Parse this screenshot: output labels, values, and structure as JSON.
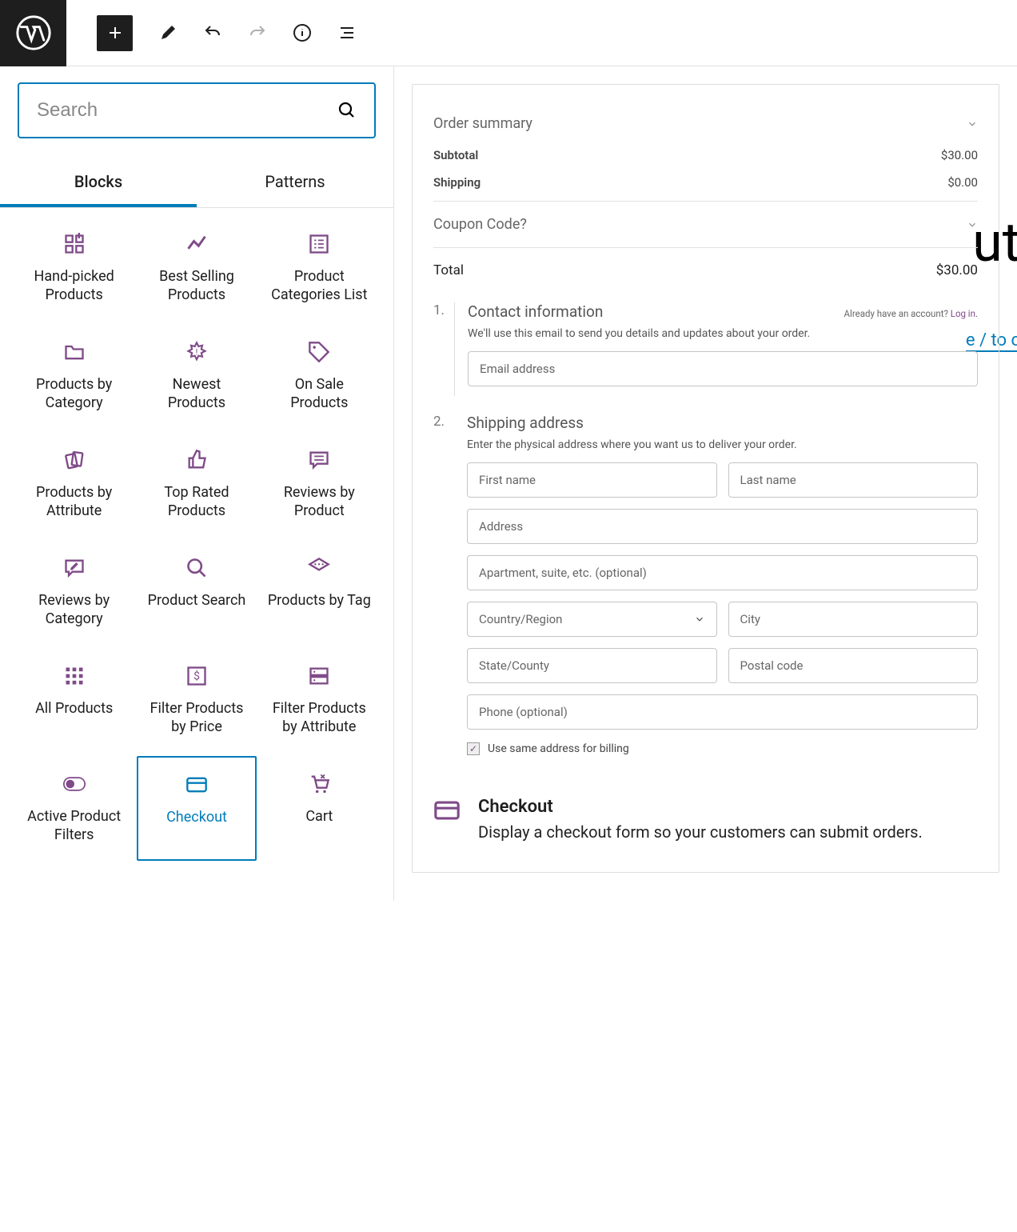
{
  "search": {
    "placeholder": "Search"
  },
  "tabs": {
    "blocks": "Blocks",
    "patterns": "Patterns"
  },
  "blocks": [
    {
      "label": "Hand-picked Products"
    },
    {
      "label": "Best Selling Products"
    },
    {
      "label": "Product Categories List"
    },
    {
      "label": "Products by Category"
    },
    {
      "label": "Newest Products"
    },
    {
      "label": "On Sale Products"
    },
    {
      "label": "Products by Attribute"
    },
    {
      "label": "Top Rated Products"
    },
    {
      "label": "Reviews by Product"
    },
    {
      "label": "Reviews by Category"
    },
    {
      "label": "Product Search"
    },
    {
      "label": "Products by Tag"
    },
    {
      "label": "All Products"
    },
    {
      "label": "Filter Products by Price"
    },
    {
      "label": "Filter Products by Attribute"
    },
    {
      "label": "Active Product Filters"
    },
    {
      "label": "Checkout"
    },
    {
      "label": "Cart"
    }
  ],
  "decor": {
    "bg1": "ut",
    "bg2": "e / to c"
  },
  "order": {
    "summary": "Order summary",
    "subtotal_k": "Subtotal",
    "subtotal_v": "$30.00",
    "shipping_k": "Shipping",
    "shipping_v": "$0.00",
    "coupon": "Coupon Code?",
    "total_k": "Total",
    "total_v": "$30.00"
  },
  "step1": {
    "num": "1.",
    "title": "Contact information",
    "note_pre": "Already have an account? ",
    "note_link": "Log in.",
    "desc": "We'll use this email to send you details and updates about your order.",
    "email": "Email address"
  },
  "step2": {
    "num": "2.",
    "title": "Shipping address",
    "desc": "Enter the physical address where you want us to deliver your order.",
    "first": "First name",
    "last": "Last name",
    "address": "Address",
    "apt": "Apartment, suite, etc. (optional)",
    "country": "Country/Region",
    "city": "City",
    "state": "State/County",
    "postal": "Postal code",
    "phone": "Phone (optional)",
    "same": "Use same address for billing"
  },
  "desc": {
    "title": "Checkout",
    "text": "Display a checkout form so your customers can submit orders."
  }
}
